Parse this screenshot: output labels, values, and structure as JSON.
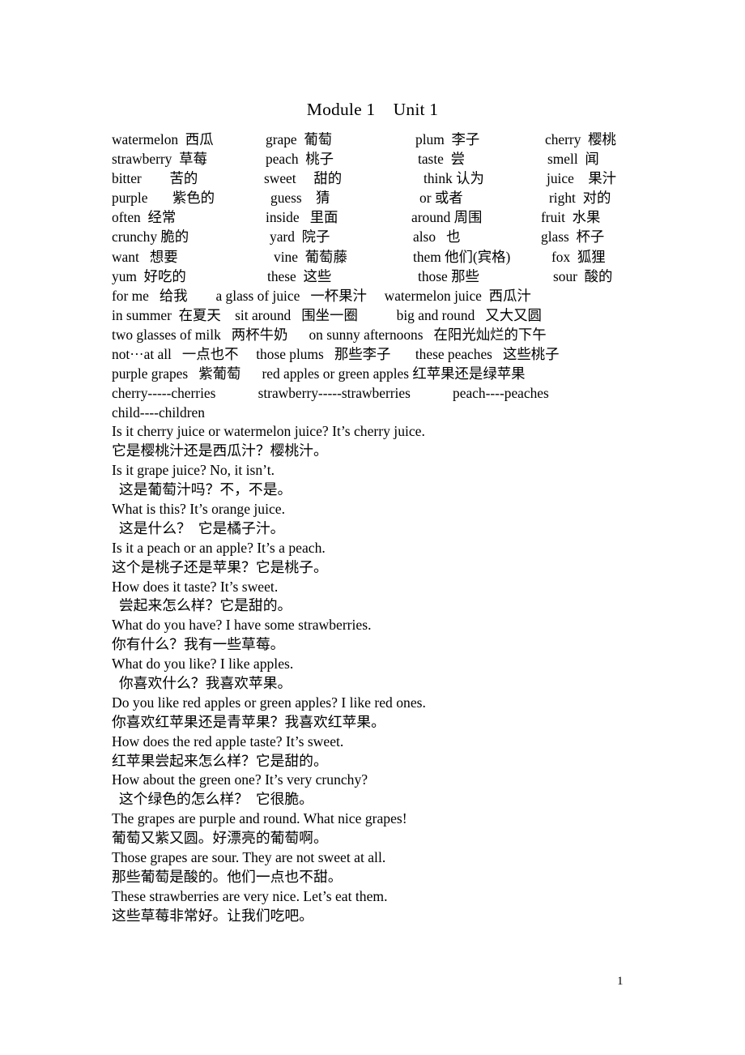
{
  "document": {
    "title": "Module 1    Unit 1",
    "page_number": "1"
  },
  "vocabulary": {
    "rows": [
      [
        {
          "en": "watermelon",
          "zh": "西瓜"
        },
        {
          "en": "grape",
          "zh": "葡萄"
        },
        {
          "en": "plum",
          "zh": "李子"
        },
        {
          "en": "cherry",
          "zh": "樱桃"
        }
      ],
      [
        {
          "en": "strawberry",
          "zh": "草莓"
        },
        {
          "en": "peach",
          "zh": "桃子"
        },
        {
          "en": "taste",
          "zh": "尝"
        },
        {
          "en": "smell",
          "zh": "闻"
        }
      ],
      [
        {
          "en": "bitter",
          "zh": "苦的"
        },
        {
          "en": "sweet",
          "zh": "甜的"
        },
        {
          "en": "think",
          "zh": "认为"
        },
        {
          "en": "juice",
          "zh": "果汁"
        }
      ],
      [
        {
          "en": "purple",
          "zh": "紫色的"
        },
        {
          "en": "guess",
          "zh": "猜"
        },
        {
          "en": "or",
          "zh": "或者"
        },
        {
          "en": "right",
          "zh": "对的"
        }
      ],
      [
        {
          "en": "often",
          "zh": "经常"
        },
        {
          "en": "inside",
          "zh": "里面"
        },
        {
          "en": "around",
          "zh": "周围"
        },
        {
          "en": "fruit",
          "zh": "水果"
        }
      ],
      [
        {
          "en": "crunchy",
          "zh": "脆的"
        },
        {
          "en": "yard",
          "zh": "院子"
        },
        {
          "en": "also",
          "zh": "也"
        },
        {
          "en": "glass",
          "zh": "杯子"
        }
      ],
      [
        {
          "en": "want",
          "zh": "想要"
        },
        {
          "en": "vine",
          "zh": "葡萄藤"
        },
        {
          "en": "them",
          "zh": "他们(宾格)"
        },
        {
          "en": "fox",
          "zh": "狐狸"
        }
      ],
      [
        {
          "en": "yum",
          "zh": "好吃的"
        },
        {
          "en": "these",
          "zh": "这些"
        },
        {
          "en": "those",
          "zh": "那些"
        },
        {
          "en": "sour",
          "zh": "酸的"
        }
      ]
    ]
  },
  "phrases": {
    "lines": [
      "for me   给我        a glass of juice   一杯果汁     watermelon juice  西瓜汁",
      "in summer  在夏天    sit around   围坐一圈           big and round   又大又圆",
      "two glasses of milk   两杯牛奶      on sunny afternoons   在阳光灿烂的下午",
      "not···at all   一点也不     those plums   那些李子       these peaches   这些桃子",
      "purple grapes   紫葡萄      red apples or green apples 红苹果还是绿苹果"
    ]
  },
  "plurals": {
    "lines": [
      "cherry-----cherries            strawberry-----strawberries            peach----peaches",
      "child----children"
    ]
  },
  "sentences": {
    "pairs": [
      {
        "en": "Is it cherry juice or watermelon juice? It’s cherry juice.",
        "zh": "它是樱桃汁还是西瓜汁？樱桃汁。"
      },
      {
        "en": "Is it grape juice? No, it isn’t.",
        "zh": "  这是葡萄汁吗？不，不是。"
      },
      {
        "en": "What is this? It’s orange juice.",
        "zh": "  这是什么？  它是橘子汁。"
      },
      {
        "en": "Is it a peach or an apple? It’s a peach.",
        "zh": "这个是桃子还是苹果？它是桃子。"
      },
      {
        "en": "How does it taste? It’s sweet.",
        "zh": "  尝起来怎么样？它是甜的。"
      },
      {
        "en": "What do you have? I have some strawberries.",
        "zh": "你有什么？我有一些草莓。"
      },
      {
        "en": "What do you like? I like apples.",
        "zh": "  你喜欢什么？我喜欢苹果。"
      },
      {
        "en": "Do you like red apples or green apples? I like red ones.",
        "zh": "你喜欢红苹果还是青苹果？我喜欢红苹果。"
      },
      {
        "en": "How does the red apple taste? It’s sweet.",
        "zh": "红苹果尝起来怎么样？它是甜的。"
      },
      {
        "en": "How about the green one? It’s very crunchy?",
        "zh": "  这个绿色的怎么样？  它很脆。"
      },
      {
        "en": "The grapes are purple and round. What nice grapes!",
        "zh": "葡萄又紫又圆。好漂亮的葡萄啊。"
      },
      {
        "en": "Those grapes are sour. They are not sweet at all.",
        "zh": "那些葡萄是酸的。他们一点也不甜。"
      },
      {
        "en": "These strawberries are very nice. Let’s eat them.",
        "zh": "这些草莓非常好。让我们吃吧。"
      }
    ]
  }
}
